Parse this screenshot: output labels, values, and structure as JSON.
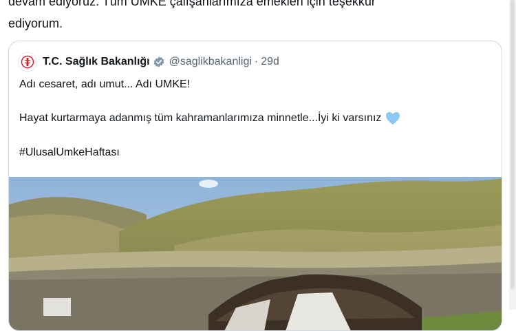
{
  "tweet": {
    "line1": "devam ediyoruz. Tüm UMKE çalışanlarımıza emekleri için teşekkür",
    "line2": "ediyorum."
  },
  "quote": {
    "display_name": "T.C. Sağlık Bakanlığı",
    "handle": "@saglikbakanligi",
    "separator": "·",
    "age": "29d",
    "verified_icon": "verified-badge-icon",
    "text_line1": "Adı cesaret, adı umut... Adı UMKE!",
    "text_line2": "Hayat kurtarmaya adanmış tüm kahramanlarımıza minnetle...İyi ki varsınız",
    "emoji": "light-blue-heart-icon",
    "hashtag": "#UlusalUmkeHaftası",
    "media_alt": "mountain-valley-with-tent-photo"
  },
  "colors": {
    "text_primary": "#0f1419",
    "text_secondary": "#536471",
    "border": "#cfd9de",
    "verified_gray": "#829aab",
    "heart_blue": "#8cc8f2",
    "logo_red": "#d1202f"
  }
}
